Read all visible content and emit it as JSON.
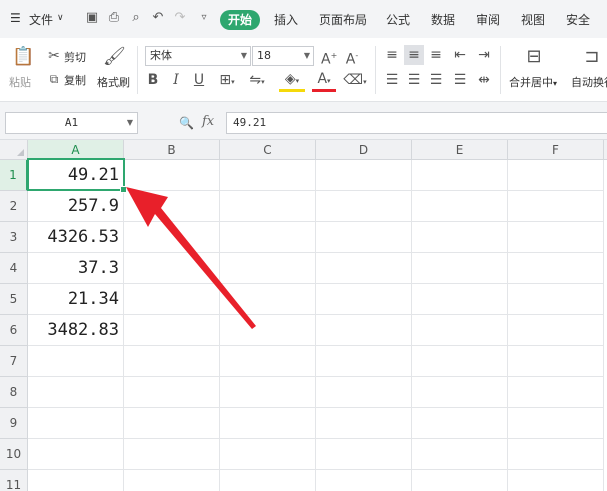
{
  "menu": {
    "file_label": "文件",
    "tabs": [
      {
        "label": "开始",
        "active": true
      },
      {
        "label": "插入"
      },
      {
        "label": "页面布局"
      },
      {
        "label": "公式"
      },
      {
        "label": "数据"
      },
      {
        "label": "审阅"
      },
      {
        "label": "视图"
      },
      {
        "label": "安全"
      }
    ],
    "quick_access_icons": [
      "save-icon",
      "print-icon",
      "print-preview-icon",
      "undo-icon",
      "redo-icon",
      "customize-icon"
    ]
  },
  "ribbon": {
    "paste_label": "粘贴",
    "cut_label": "剪切",
    "copy_label": "复制",
    "format_painter_label": "格式刷",
    "font_name": "宋体",
    "font_size": "18",
    "bold": "B",
    "italic": "I",
    "underline": "U",
    "merge_center_label": "合并居中",
    "wrap_label": "自动换行",
    "accent_color": "#2ea76f"
  },
  "formula_bar": {
    "name_box": "A1",
    "fx_label": "fx",
    "formula_value": "49.21"
  },
  "sheet": {
    "columns": [
      "A",
      "B",
      "C",
      "D",
      "E",
      "F"
    ],
    "selected_column": "A",
    "rows": [
      "1",
      "2",
      "3",
      "4",
      "5",
      "6",
      "7",
      "8",
      "9",
      "10",
      "11"
    ],
    "selected_row": "1",
    "column_a_values": [
      "49.21",
      "257.9",
      "4326.53",
      "37.3",
      "21.34",
      "3482.83"
    ],
    "active_cell": "A1"
  },
  "annotation": {
    "arrow_color": "#e8202a"
  }
}
